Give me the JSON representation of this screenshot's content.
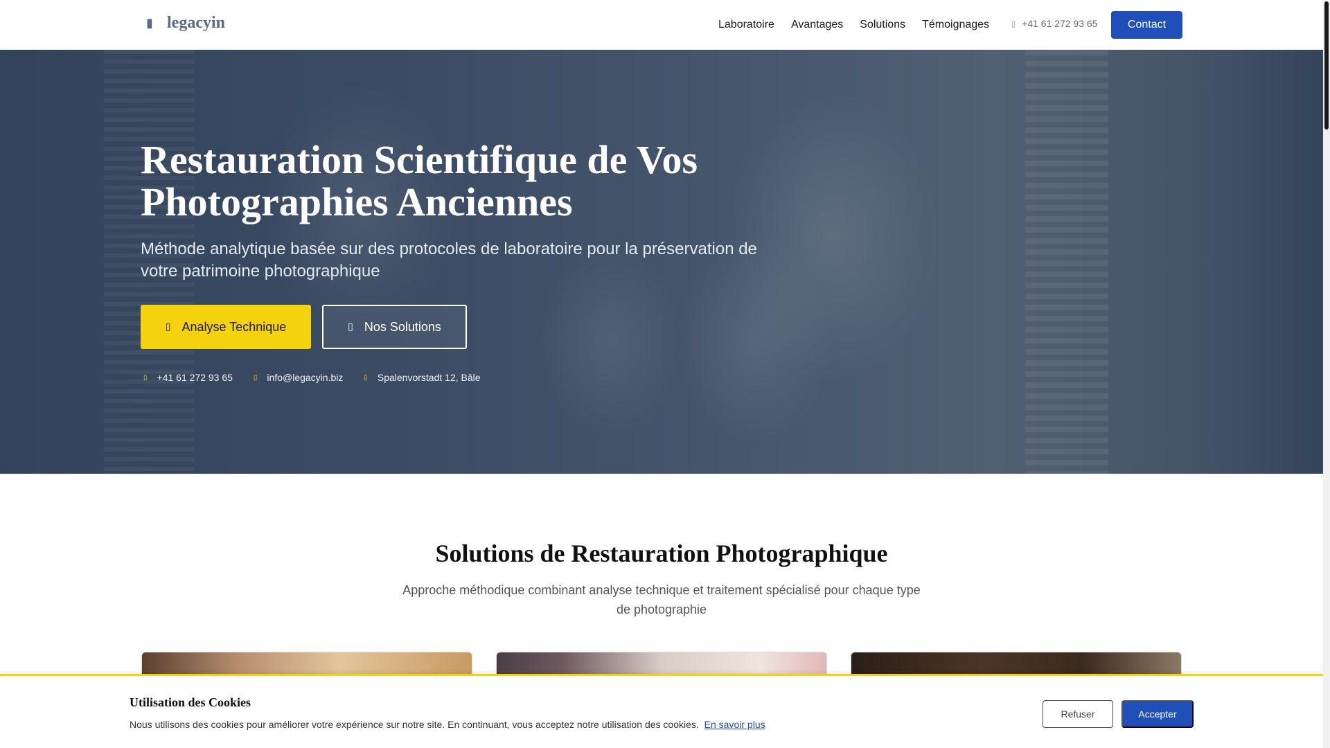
{
  "header": {
    "logo_icon": "camera-icon",
    "logo_text": "legacyin",
    "nav": [
      "Laboratoire",
      "Avantages",
      "Solutions",
      "Témoignages"
    ],
    "phone_icon": "phone-icon",
    "phone": "+41 61 272 93 65",
    "contact_label": "Contact"
  },
  "hero": {
    "title": "Restauration Scientifique de Vos Photographies Anciennes",
    "subtitle": "Méthode analytique basée sur des protocoles de laboratoire pour la préservation de votre patrimoine photographique",
    "primary_button": "Analyse Technique",
    "secondary_button": "Nos Solutions",
    "contacts": {
      "phone": "+41 61 272 93 65",
      "email": "info@legacyin.biz",
      "address": "Spalenvorstadt 12, Bâle"
    }
  },
  "section": {
    "title": "Solutions de Restauration Photographique",
    "subtitle": "Approche méthodique combinant analyse technique et traitement spécialisé pour chaque type de photographie"
  },
  "cookie": {
    "title": "Utilisation des Cookies",
    "text": "Nous utilisons des cookies pour améliorer votre expérience sur notre site. En continuant, vous acceptez notre utilisation des cookies.",
    "link": "En savoir plus",
    "refuse": "Refuser",
    "accept": "Accepter"
  },
  "colors": {
    "brand_blue": "#1f4fb8",
    "accent_yellow": "#f5d20e"
  }
}
